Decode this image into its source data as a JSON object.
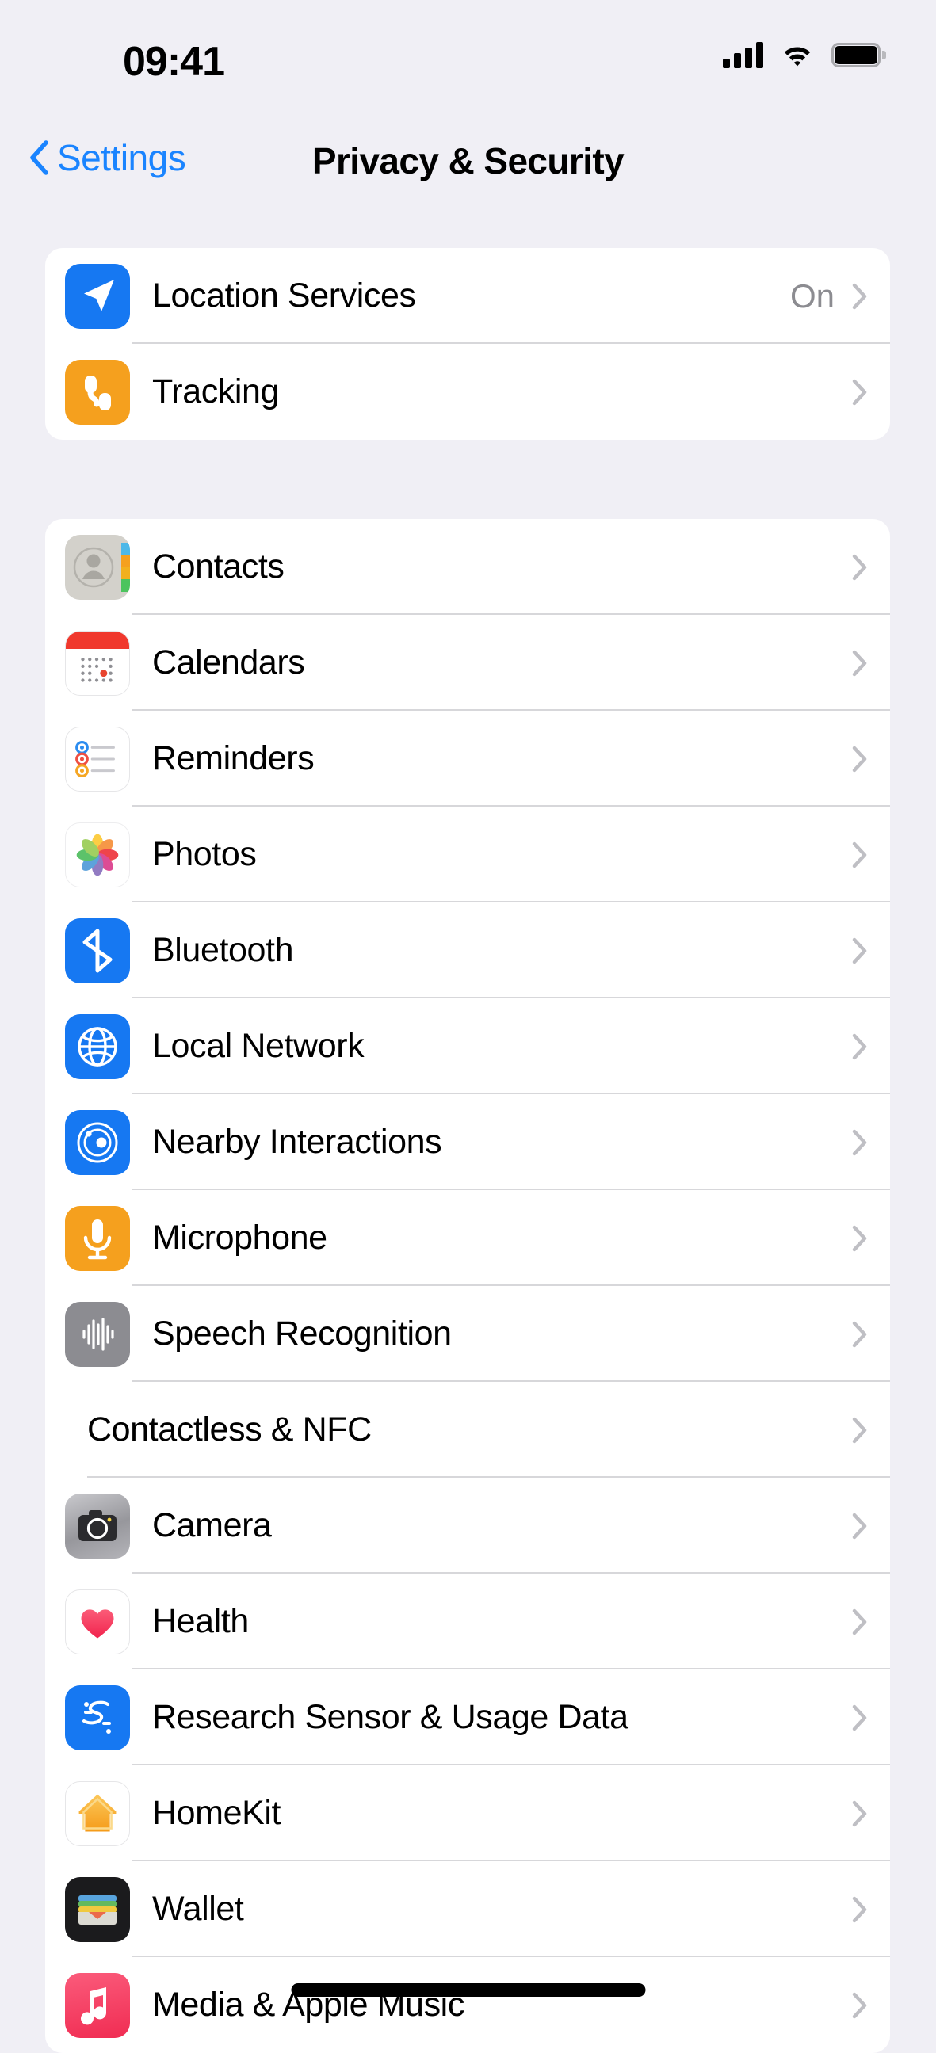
{
  "status_bar": {
    "time": "09:41",
    "cellular_icon": "cellular-signal-icon",
    "wifi_icon": "wifi-icon",
    "battery_icon": "battery-full-icon"
  },
  "nav_bar": {
    "back_label": "Settings",
    "back_icon": "chevron-left-icon",
    "title": "Privacy & Security"
  },
  "groups": [
    {
      "id": "group-1",
      "rows": [
        {
          "label": "Location Services",
          "value": "On",
          "icon": "location-arrow-icon"
        },
        {
          "label": "Tracking",
          "value": "",
          "icon": "tracking-link-icon"
        }
      ]
    },
    {
      "id": "group-2",
      "rows": [
        {
          "label": "Contacts",
          "value": "",
          "icon": "contacts-app-icon"
        },
        {
          "label": "Calendars",
          "value": "",
          "icon": "calendar-app-icon"
        },
        {
          "label": "Reminders",
          "value": "",
          "icon": "reminders-app-icon"
        },
        {
          "label": "Photos",
          "value": "",
          "icon": "photos-app-icon"
        },
        {
          "label": "Bluetooth",
          "value": "",
          "icon": "bluetooth-icon"
        },
        {
          "label": "Local Network",
          "value": "",
          "icon": "globe-network-icon"
        },
        {
          "label": "Nearby Interactions",
          "value": "",
          "icon": "nearby-radar-icon"
        },
        {
          "label": "Speech Recognition",
          "value": "",
          "icon": "speech-waveform-icon"
        },
        {
          "label": "Contactless & NFC",
          "value": "",
          "icon": ""
        },
        {
          "label": "Camera",
          "value": "",
          "icon": "camera-app-icon"
        },
        {
          "label": "Health",
          "value": "",
          "icon": "health-heart-icon"
        },
        {
          "label": "Research Sensor & Usage Data",
          "value": "",
          "icon": "research-sensor-icon"
        },
        {
          "label": "HomeKit",
          "value": "",
          "icon": "homekit-house-icon"
        },
        {
          "label": "Wallet",
          "value": "",
          "icon": "wallet-app-icon"
        },
        {
          "label": "Media & Apple Music",
          "value": "",
          "icon": "apple-music-icon"
        }
      ]
    }
  ],
  "home_indicator": "home-indicator",
  "colors": {
    "page_background": "#f0eff5",
    "card_background": "#ffffff",
    "accent_blue": "#1a84ff",
    "value_grey": "#8c8c91",
    "separator": "#d7d7da"
  }
}
